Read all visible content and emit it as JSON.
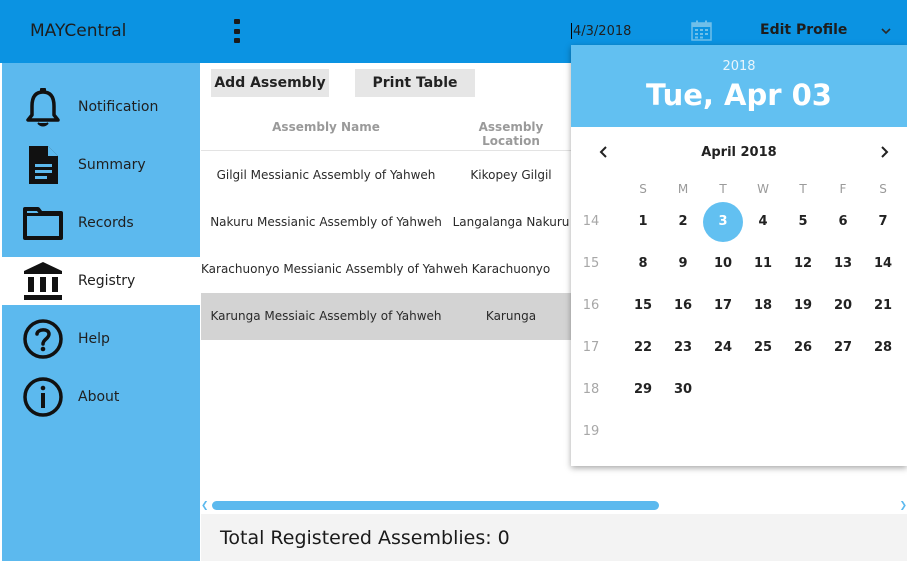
{
  "app": {
    "title": "MAYCentral"
  },
  "topbar": {
    "date_value": "4/3/2018",
    "profile_label": "Edit Profile"
  },
  "sidebar": {
    "items": [
      {
        "label": "Notification",
        "icon": "bell-icon"
      },
      {
        "label": "Summary",
        "icon": "document-icon"
      },
      {
        "label": "Records",
        "icon": "folder-icon"
      },
      {
        "label": "Registry",
        "icon": "bank-icon",
        "active": true
      },
      {
        "label": "Help",
        "icon": "help-circle-icon"
      },
      {
        "label": "About",
        "icon": "info-circle-icon"
      }
    ]
  },
  "toolbar": {
    "add_label": "Add Assembly",
    "print_label": "Print Table"
  },
  "table": {
    "columns": [
      "Assembly Name",
      "Assembly Location"
    ],
    "rows": [
      {
        "name": "Gilgil Messianic Assembly of Yahweh",
        "location": "Kikopey Gilgil"
      },
      {
        "name": "Nakuru Messianic Assembly of Yahweh",
        "location": "Langalanga Nakuru"
      },
      {
        "name": "Karachuonyo Messianic Assembly of Yahweh",
        "location": "Karachuonyo"
      },
      {
        "name": "Karunga Messiaic Assembly of Yahweh",
        "location": "Karunga",
        "selected": true
      }
    ]
  },
  "footer": {
    "total_text": "Total Registered Assemblies: 0"
  },
  "calendar": {
    "year": "2018",
    "selected_date_text": "Tue, Apr 03",
    "month_label": "April 2018",
    "day_headers": [
      "S",
      "M",
      "T",
      "W",
      "T",
      "F",
      "S"
    ],
    "weeks": [
      {
        "week": "14",
        "days": [
          "1",
          "2",
          "3",
          "4",
          "5",
          "6",
          "7"
        ]
      },
      {
        "week": "15",
        "days": [
          "8",
          "9",
          "10",
          "11",
          "12",
          "13",
          "14"
        ]
      },
      {
        "week": "16",
        "days": [
          "15",
          "16",
          "17",
          "18",
          "19",
          "20",
          "21"
        ]
      },
      {
        "week": "17",
        "days": [
          "22",
          "23",
          "24",
          "25",
          "26",
          "27",
          "28"
        ]
      },
      {
        "week": "18",
        "days": [
          "29",
          "30",
          "",
          "",
          "",
          "",
          ""
        ]
      },
      {
        "week": "19",
        "days": [
          "",
          "",
          "",
          "",
          "",
          "",
          ""
        ]
      }
    ],
    "selected_day": "3",
    "accent_color": "#62c0f1"
  },
  "colors": {
    "topbar": "#0b93e2",
    "sidebar": "#5cb9ee",
    "accent": "#62c0f1"
  }
}
